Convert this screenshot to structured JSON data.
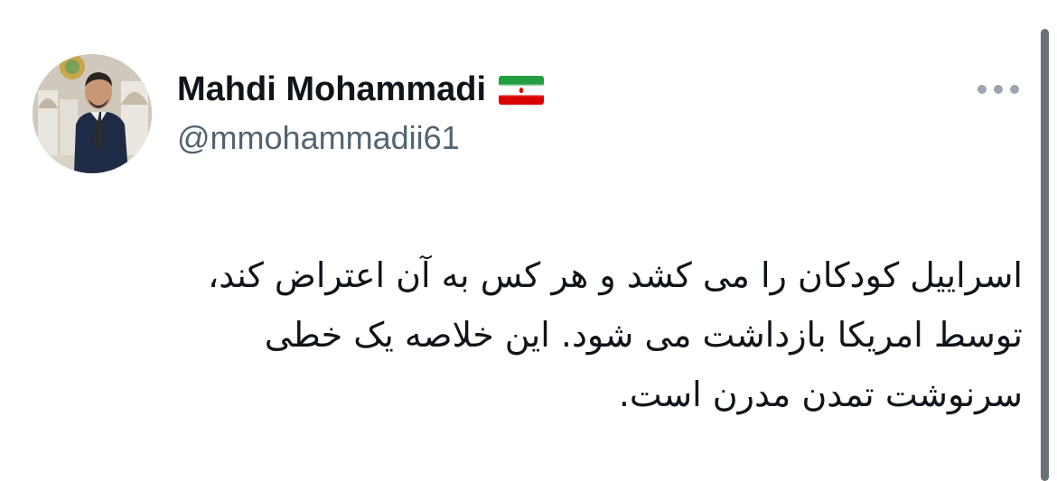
{
  "tweet": {
    "author": {
      "display_name": "Mahdi Mohammadi",
      "handle": "@mmohammadii61",
      "flag_icon": "iran-flag-icon",
      "avatar_icon": "profile-photo-avatar"
    },
    "more_icon": "more-options-icon",
    "text_lines": [
      "اسراییل کودکان را می کشد و هر کس به آن اعتراض کند،",
      "توسط امریکا بازداشت می شود. این خلاصه یک خطی",
      "سرنوشت تمدن مدرن است."
    ]
  },
  "colors": {
    "text_primary": "#0f1419",
    "text_secondary": "#536471",
    "flag_green": "#239f40",
    "flag_red": "#da0000",
    "scrollbar": "#6b7178"
  }
}
